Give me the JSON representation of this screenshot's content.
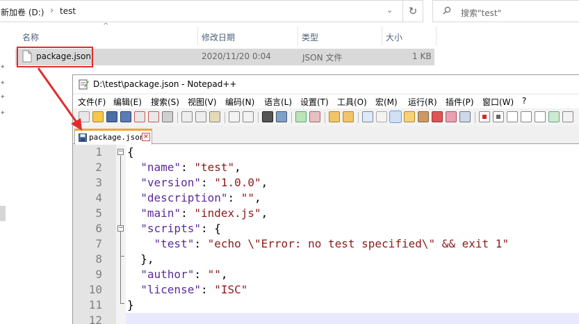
{
  "explorer": {
    "breadcrumb": [
      "新加卷 (D:)",
      "test"
    ],
    "search_placeholder": "搜索\"test\"",
    "columns": {
      "name": "名称",
      "modified": "修改日期",
      "type": "类型",
      "size": "大小"
    },
    "files": [
      {
        "name": "package.json",
        "modified": "2020/11/20 0:04",
        "type": "JSON 文件",
        "size": "1 KB"
      }
    ]
  },
  "notepad": {
    "title": "D:\\test\\package.json - Notepad++",
    "menu": [
      "文件(F)",
      "编辑(E)",
      "搜索(S)",
      "视图(V)",
      "编码(N)",
      "语言(L)",
      "设置(T)",
      "工具(O)",
      "宏(M)",
      "运行(R)",
      "插件(P)",
      "窗口(W)",
      "?"
    ],
    "tab_label": "package.json",
    "lines": [
      {
        "n": "1",
        "parts": [
          [
            "p",
            "{"
          ]
        ]
      },
      {
        "n": "2",
        "parts": [
          [
            "p",
            "  "
          ],
          [
            "k",
            "\"name\""
          ],
          [
            "p",
            ": "
          ],
          [
            "s",
            "\"test\""
          ],
          [
            "p",
            ","
          ]
        ]
      },
      {
        "n": "3",
        "parts": [
          [
            "p",
            "  "
          ],
          [
            "k",
            "\"version\""
          ],
          [
            "p",
            ": "
          ],
          [
            "s",
            "\"1.0.0\""
          ],
          [
            "p",
            ","
          ]
        ]
      },
      {
        "n": "4",
        "parts": [
          [
            "p",
            "  "
          ],
          [
            "k",
            "\"description\""
          ],
          [
            "p",
            ": "
          ],
          [
            "s",
            "\"\""
          ],
          [
            "p",
            ","
          ]
        ]
      },
      {
        "n": "5",
        "parts": [
          [
            "p",
            "  "
          ],
          [
            "k",
            "\"main\""
          ],
          [
            "p",
            ": "
          ],
          [
            "s",
            "\"index.js\""
          ],
          [
            "p",
            ","
          ]
        ]
      },
      {
        "n": "6",
        "parts": [
          [
            "p",
            "  "
          ],
          [
            "k",
            "\"scripts\""
          ],
          [
            "p",
            ": {"
          ]
        ]
      },
      {
        "n": "7",
        "parts": [
          [
            "p",
            "    "
          ],
          [
            "k",
            "\"test\""
          ],
          [
            "p",
            ": "
          ],
          [
            "s",
            "\"echo \\\"Error: no test specified\\\" && exit 1\""
          ]
        ]
      },
      {
        "n": "8",
        "parts": [
          [
            "p",
            "  },"
          ]
        ]
      },
      {
        "n": "9",
        "parts": [
          [
            "p",
            "  "
          ],
          [
            "k",
            "\"author\""
          ],
          [
            "p",
            ": "
          ],
          [
            "s",
            "\"\""
          ],
          [
            "p",
            ","
          ]
        ]
      },
      {
        "n": "10",
        "parts": [
          [
            "p",
            "  "
          ],
          [
            "k",
            "\"license\""
          ],
          [
            "p",
            ": "
          ],
          [
            "s",
            "\"ISC\""
          ]
        ]
      },
      {
        "n": "11",
        "parts": [
          [
            "p",
            "}"
          ]
        ]
      },
      {
        "n": "12",
        "parts": []
      }
    ]
  },
  "colors": {
    "annotation": "#e02b2b",
    "key": "#5a2a9c",
    "string": "#8b1a1a",
    "tab_accent": "#f0a33a"
  }
}
